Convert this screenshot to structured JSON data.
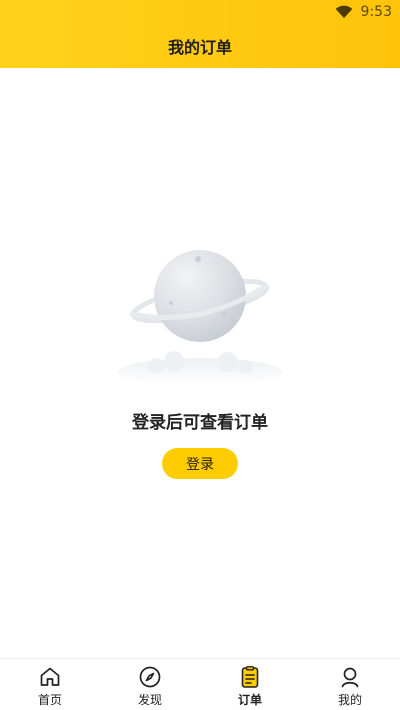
{
  "status": {
    "time": "9:53"
  },
  "header": {
    "title": "我的订单"
  },
  "empty": {
    "message": "登录后可查看订单",
    "login_label": "登录"
  },
  "tabs": [
    {
      "label": "首页",
      "icon": "home-icon"
    },
    {
      "label": "发现",
      "icon": "compass-icon"
    },
    {
      "label": "订单",
      "icon": "order-icon",
      "active": true
    },
    {
      "label": "我的",
      "icon": "user-icon"
    }
  ],
  "colors": {
    "accent": "#ffcc00"
  }
}
